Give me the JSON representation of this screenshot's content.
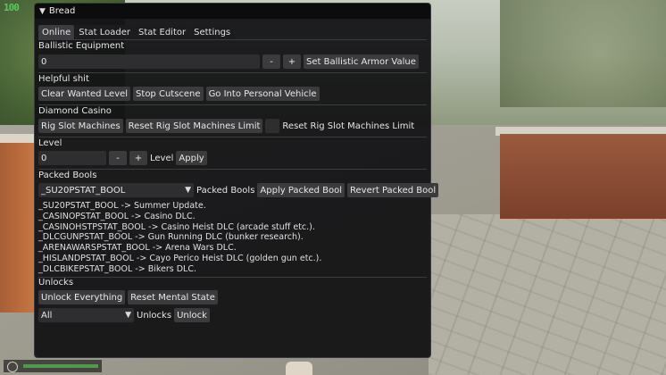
{
  "hud": {
    "ammo": "100"
  },
  "window": {
    "title": "Bread",
    "tabs": [
      {
        "label": "Online",
        "active": true
      },
      {
        "label": "Stat Loader"
      },
      {
        "label": "Stat Editor"
      },
      {
        "label": "Settings"
      }
    ]
  },
  "ballistic": {
    "header": "Ballistic Equipment",
    "value": "0",
    "minus": "-",
    "plus": "+",
    "set_button": "Set Ballistic Armor Value"
  },
  "helpful": {
    "header": "Helpful shit",
    "buttons": [
      "Clear Wanted Level",
      "Stop Cutscene",
      "Go Into Personal Vehicle"
    ]
  },
  "casino": {
    "header": "Diamond Casino",
    "rig_button": "Rig Slot Machines",
    "reset_button": "Reset Rig Slot Machines Limit",
    "checkbox_label": "Reset Rig Slot Machines Limit"
  },
  "level": {
    "header": "Level",
    "value": "0",
    "minus": "-",
    "plus": "+",
    "label": "Level",
    "apply_button": "Apply"
  },
  "packed": {
    "header": "Packed Bools",
    "selected": "_SU20PSTAT_BOOL",
    "label": "Packed Bools",
    "apply_button": "Apply Packed Bool",
    "revert_button": "Revert Packed Bool",
    "descriptions": [
      "_SU20PSTAT_BOOL -> Summer Update.",
      "_CASINOPSTAT_BOOL -> Casino DLC.",
      "_CASINOHSTPSTAT_BOOL -> Casino Heist DLC (arcade stuff etc.).",
      "_DLCGUNPSTAT_BOOL -> Gun Running DLC (bunker research).",
      "_ARENAWARSPSTAT_BOOL -> Arena Wars DLC.",
      "_HISLANDPSTAT_BOOL -> Cayo Perico Heist DLC (golden gun etc.).",
      "_DLCBIKEPSTAT_BOOL -> Bikers DLC."
    ]
  },
  "unlocks": {
    "header": "Unlocks",
    "unlock_everything": "Unlock Everything",
    "reset_mental": "Reset Mental State",
    "selected": "All",
    "label": "Unlocks",
    "unlock_button": "Unlock"
  }
}
